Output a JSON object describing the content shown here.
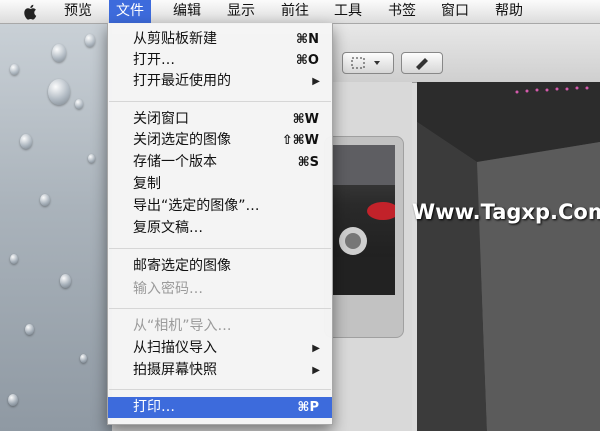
{
  "menubar": {
    "items": [
      {
        "label": "预览"
      },
      {
        "label": "文件"
      },
      {
        "label": "编辑"
      },
      {
        "label": "显示"
      },
      {
        "label": "前往"
      },
      {
        "label": "工具"
      },
      {
        "label": "书签"
      },
      {
        "label": "窗口"
      },
      {
        "label": "帮助"
      }
    ]
  },
  "file_menu": {
    "groups": [
      [
        {
          "label": "从剪贴板新建",
          "shortcut": "⌘N"
        },
        {
          "label": "打开…",
          "shortcut": "⌘O"
        },
        {
          "label": "打开最近使用的",
          "submenu": "▶"
        }
      ],
      [
        {
          "label": "关闭窗口",
          "shortcut": "⌘W"
        },
        {
          "label": "关闭选定的图像",
          "shortcut": "⇧⌘W"
        },
        {
          "label": "存储一个版本",
          "shortcut": "⌘S"
        },
        {
          "label": "复制"
        },
        {
          "label": "导出“选定的图像”…"
        },
        {
          "label": "复原文稿…"
        }
      ],
      [
        {
          "label": "邮寄选定的图像"
        },
        {
          "label": "输入密码…",
          "disabled": true
        }
      ],
      [
        {
          "label": "从“相机”导入…",
          "disabled": true
        },
        {
          "label": "从扫描仪导入",
          "submenu": "▶"
        },
        {
          "label": "拍摄屏幕快照",
          "submenu": "▶"
        }
      ],
      [
        {
          "label": "打印…",
          "shortcut": "⌘P",
          "selected": true
        }
      ]
    ]
  },
  "watermark": {
    "text": "Www.Tagxp.Com"
  },
  "colors": {
    "menu_highlight": "#3d6bdc"
  }
}
